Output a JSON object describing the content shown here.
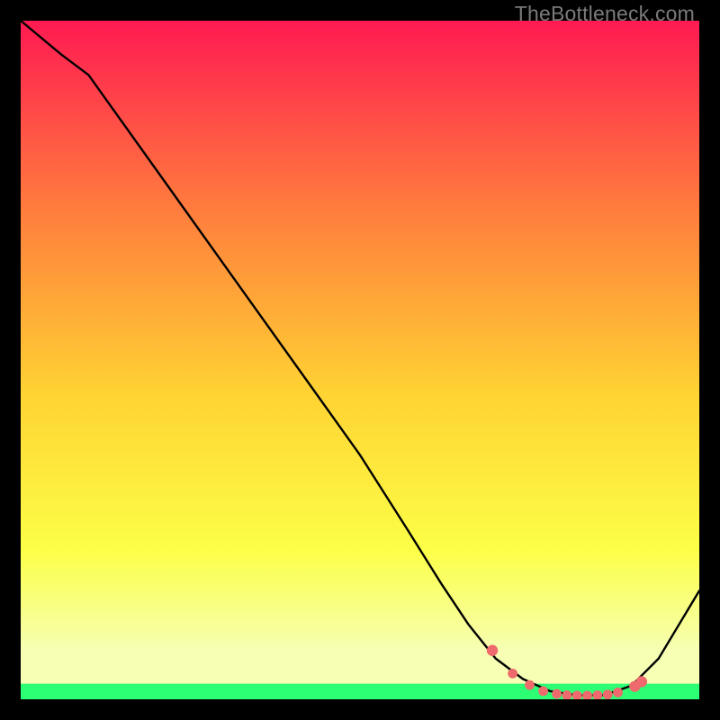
{
  "watermark": "TheBottleneck.com",
  "colors": {
    "top": "#ff1a52",
    "midUpper": "#ff7d3d",
    "mid": "#ffd333",
    "midLower": "#fcff47",
    "low": "#f6ffb4",
    "bottomBand": "#2cff73",
    "curve": "#000000",
    "dot": "#ef6a6d"
  },
  "chart_data": {
    "type": "line",
    "title": "",
    "xlabel": "",
    "ylabel": "",
    "xlim": [
      0,
      100
    ],
    "ylim": [
      0,
      100
    ],
    "curve": {
      "x": [
        0,
        6,
        10,
        20,
        30,
        40,
        50,
        57,
        62,
        66,
        70,
        74,
        78,
        82,
        86,
        90,
        94,
        100
      ],
      "y": [
        100,
        95,
        92,
        78,
        64,
        50,
        36,
        25,
        17,
        11,
        6,
        3,
        1.2,
        0.6,
        0.6,
        2,
        6,
        16
      ]
    },
    "dots": {
      "x": [
        69.5,
        72.5,
        75,
        77,
        79,
        80.5,
        82,
        83.5,
        85,
        86.5,
        88,
        90.5,
        91.5
      ],
      "y": [
        7.2,
        3.8,
        2.1,
        1.2,
        0.8,
        0.6,
        0.55,
        0.55,
        0.6,
        0.7,
        1.0,
        1.9,
        2.6
      ]
    },
    "green_band_y": [
      0,
      2.3
    ]
  }
}
